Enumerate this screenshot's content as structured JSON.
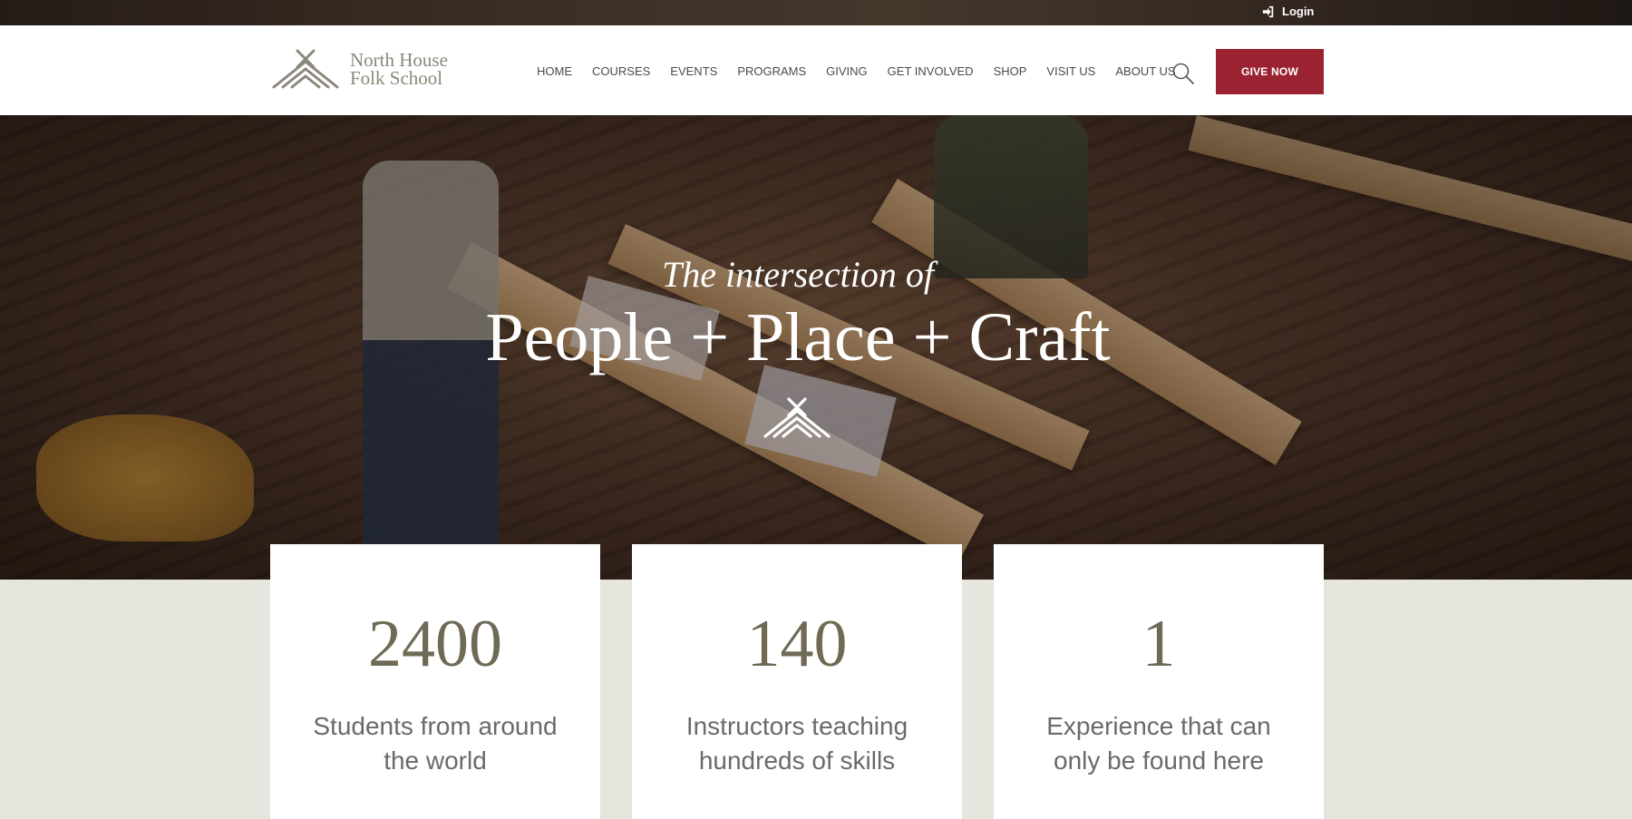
{
  "topbar": {
    "login_label": "Login"
  },
  "header": {
    "logo_line1": "North House",
    "logo_line2": "Folk School",
    "nav": [
      "HOME",
      "COURSES",
      "EVENTS",
      "PROGRAMS",
      "GIVING",
      "GET INVOLVED",
      "SHOP",
      "VISIT US",
      "ABOUT US"
    ],
    "give_label": "GIVE NOW"
  },
  "hero": {
    "subtitle": "The intersection of",
    "title": "People + Place + Craft"
  },
  "stats": [
    {
      "value": "2400",
      "label": "Students from around the world"
    },
    {
      "value": "140",
      "label": "Instructors teaching hundreds of skills"
    },
    {
      "value": "1",
      "label": "Experience that can only be found here"
    }
  ],
  "colors": {
    "brand_red": "#9a2231",
    "stat_number": "#6f6a55",
    "page_bg": "#e6e5de"
  },
  "icons": {
    "login": "sign-in-icon",
    "search": "search-icon",
    "logo": "north-house-logo-mark"
  }
}
